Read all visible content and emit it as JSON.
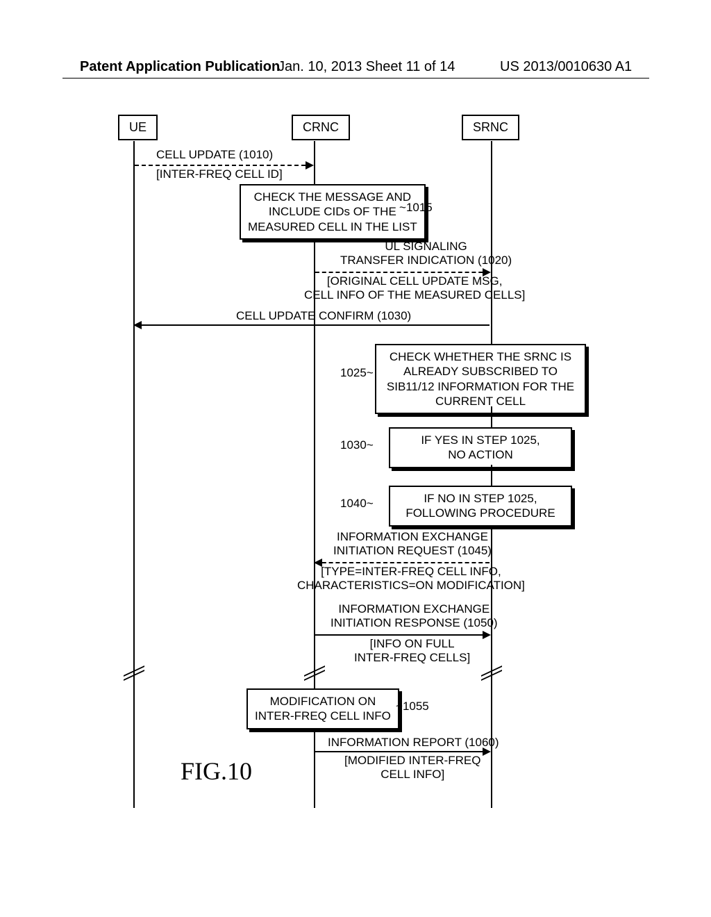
{
  "header": {
    "left": "Patent Application Publication",
    "mid": "Jan. 10, 2013  Sheet 11 of 14",
    "right": "US 2013/0010630 A1"
  },
  "actors": {
    "ue": "UE",
    "crnc": "CRNC",
    "srnc": "SRNC"
  },
  "messages": {
    "m1010": "CELL UPDATE (1010)",
    "m1010sub": "[INTER-FREQ CELL ID]",
    "m1020": "UL SIGNALING\nTRANSFER INDICATION (1020)",
    "m1020sub": "[ORIGINAL CELL UPDATE MSG,\nCELL INFO OF THE MEASURED CELLS]",
    "m1030msg": "CELL UPDATE CONFIRM (1030)",
    "m1045": "INFORMATION EXCHANGE\nINITIATION REQUEST (1045)",
    "m1045sub": "[TYPE=INTER-FREQ CELL INFO,\nCHARACTERISTICS=ON MODIFICATION]",
    "m1050": "INFORMATION EXCHANGE\nINITIATION RESPONSE (1050)",
    "m1050sub": "[INFO ON FULL\nINTER-FREQ CELLS]",
    "m1060": "INFORMATION REPORT (1060)",
    "m1060sub": "[MODIFIED INTER-FREQ\nCELL INFO]"
  },
  "boxes": {
    "b1015": "CHECK THE MESSAGE AND\nINCLUDE CIDs OF THE\nMEASURED CELL IN THE LIST",
    "b1025": "CHECK WHETHER THE SRNC IS\nALREADY SUBSCRIBED TO\nSIB11/12 INFORMATION FOR THE\nCURRENT CELL",
    "b1030": "IF YES IN STEP 1025,\nNO ACTION",
    "b1040": "IF NO IN STEP 1025,\nFOLLOWING PROCEDURE",
    "b1055": "MODIFICATION ON\nINTER-FREQ CELL INFO"
  },
  "refs": {
    "r1015": "1015",
    "r1025": "1025",
    "r1030": "1030",
    "r1040": "1040",
    "r1055": "1055"
  },
  "figure": "FIG.10",
  "chart_data": {
    "type": "sequence-diagram",
    "actors": [
      "UE",
      "CRNC",
      "SRNC"
    ],
    "steps": [
      {
        "id": "1010",
        "from": "UE",
        "to": "CRNC",
        "kind": "message",
        "label": "CELL UPDATE",
        "params": "[INTER-FREQ CELL ID]"
      },
      {
        "id": "1015",
        "at": "CRNC",
        "kind": "process",
        "label": "CHECK THE MESSAGE AND INCLUDE CIDs OF THE MEASURED CELL IN THE LIST"
      },
      {
        "id": "1020",
        "from": "CRNC",
        "to": "SRNC",
        "kind": "message",
        "label": "UL SIGNALING TRANSFER INDICATION",
        "params": "[ORIGINAL CELL UPDATE MSG, CELL INFO OF THE MEASURED CELLS]"
      },
      {
        "id": "1030-msg",
        "from": "SRNC",
        "to": "UE",
        "kind": "message",
        "label": "CELL UPDATE CONFIRM (1030)"
      },
      {
        "id": "1025",
        "at": "SRNC",
        "kind": "process",
        "label": "CHECK WHETHER THE SRNC IS ALREADY SUBSCRIBED TO SIB11/12 INFORMATION FOR THE CURRENT CELL"
      },
      {
        "id": "1030",
        "at": "SRNC",
        "kind": "process",
        "label": "IF YES IN STEP 1025, NO ACTION"
      },
      {
        "id": "1040",
        "at": "SRNC",
        "kind": "process",
        "label": "IF NO IN STEP 1025, FOLLOWING PROCEDURE"
      },
      {
        "id": "1045",
        "from": "SRNC",
        "to": "CRNC",
        "kind": "message",
        "label": "INFORMATION EXCHANGE INITIATION REQUEST",
        "params": "[TYPE=INTER-FREQ CELL INFO, CHARACTERISTICS=ON MODIFICATION]"
      },
      {
        "id": "1050",
        "from": "CRNC",
        "to": "SRNC",
        "kind": "message",
        "label": "INFORMATION EXCHANGE INITIATION RESPONSE",
        "params": "[INFO ON FULL INTER-FREQ CELLS]"
      },
      {
        "id": "1055",
        "at": "CRNC",
        "kind": "process",
        "label": "MODIFICATION ON INTER-FREQ CELL INFO"
      },
      {
        "id": "1060",
        "from": "CRNC",
        "to": "SRNC",
        "kind": "message",
        "label": "INFORMATION REPORT",
        "params": "[MODIFIED INTER-FREQ CELL INFO]"
      }
    ]
  }
}
